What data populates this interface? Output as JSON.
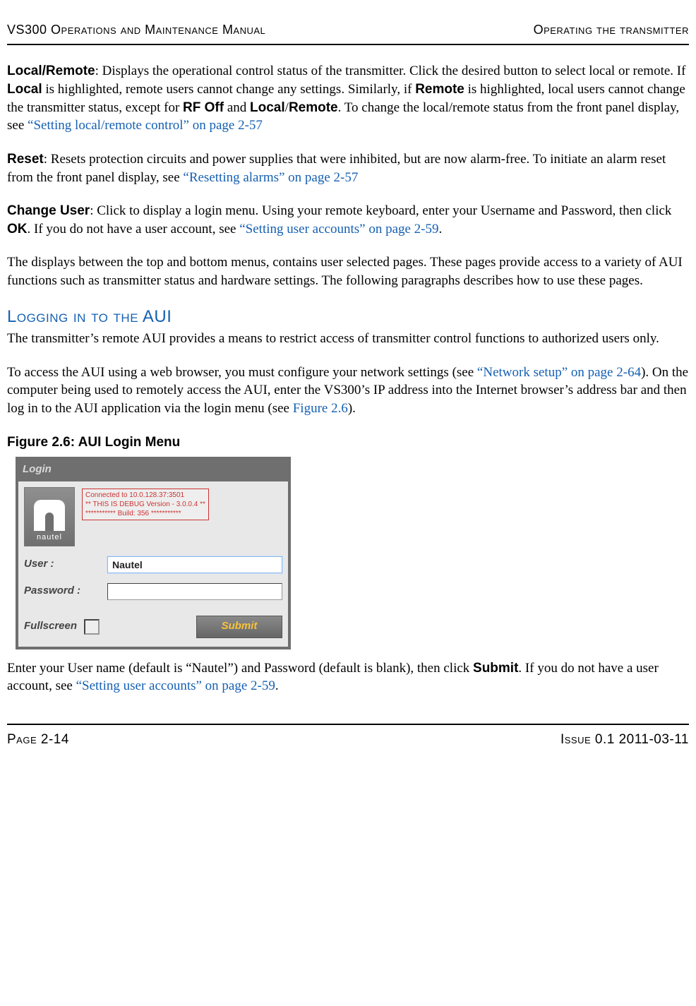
{
  "header": {
    "left": "VS300 Operations and Maintenance Manual",
    "right": "Operating the transmitter"
  },
  "para1": {
    "b1": "Local/Remote",
    "t1": ": Displays the operational control status of the transmitter. Click the desired button to select local or remote. If ",
    "b2": "Local",
    "t2": " is highlighted, remote users cannot change any settings. Similarly, if ",
    "b3": "Remote",
    "t3": " is highlighted, local users cannot change the transmitter status, except for ",
    "b4": "RF Off",
    "t4": " and ",
    "b5": "Local",
    "t5": "/",
    "b6": "Remote",
    "t6": ". To change the local/remote status from the front panel display, see ",
    "link": "“Setting local/remote control” on page 2-57"
  },
  "para2": {
    "b1": "Reset",
    "t1": ": Resets protection circuits and power supplies that were inhibited, but are now alarm-free. To initiate an alarm reset from the front panel display, see ",
    "link": "“Resetting alarms” on page 2-57"
  },
  "para3": {
    "b1": "Change User",
    "t1": ": Click to display a login menu. Using your remote keyboard, enter your Username and Password, then click ",
    "b2": "OK",
    "t2": ". If you do not have a user account, see ",
    "link": "“Setting user accounts” on page 2-59",
    "t3": "."
  },
  "para4": "The displays between the top and bottom menus, contains user selected pages. These pages provide access to a variety of AUI functions such as transmitter status and hardware settings. The following paragraphs describes how to use these pages.",
  "heading": "Logging in to the AUI",
  "para5": "The transmitter’s remote AUI provides a means to restrict access of transmitter control functions to authorized users only.",
  "para6": {
    "t1": "To access the AUI using a web browser, you must configure your network settings (see ",
    "link1": "“Network setup” on page 2-64",
    "t2": "). On the computer being used to remotely access the AUI, enter the VS300’s IP address into the Internet browser’s address bar and then log in to the AUI application via the login menu (see ",
    "link2": "Figure 2.6",
    "t3": ")."
  },
  "figure": {
    "caption": "Figure 2.6: AUI Login Menu",
    "title": "Login",
    "brand": "nautel",
    "debug_l1": "Connected to 10.0.128.37:3501",
    "debug_l2": "** THIS IS DEBUG Version - 3.0.0.4 **",
    "debug_l3": "*********** Build: 356 ***********",
    "user_label": "User :",
    "user_value": "Nautel",
    "password_label": "Password :",
    "password_value": "",
    "fullscreen_label": "Fullscreen",
    "submit_label": "Submit"
  },
  "para7": {
    "t1": "Enter your User name (default is “Nautel”) and Password (default is blank), then click ",
    "b1": "Submit",
    "t2": ". If you do not have a user account, see ",
    "link": "“Setting user accounts” on page 2-59",
    "t3": "."
  },
  "footer": {
    "left": "Page 2-14",
    "right": "Issue 0.1  2011-03-11"
  }
}
